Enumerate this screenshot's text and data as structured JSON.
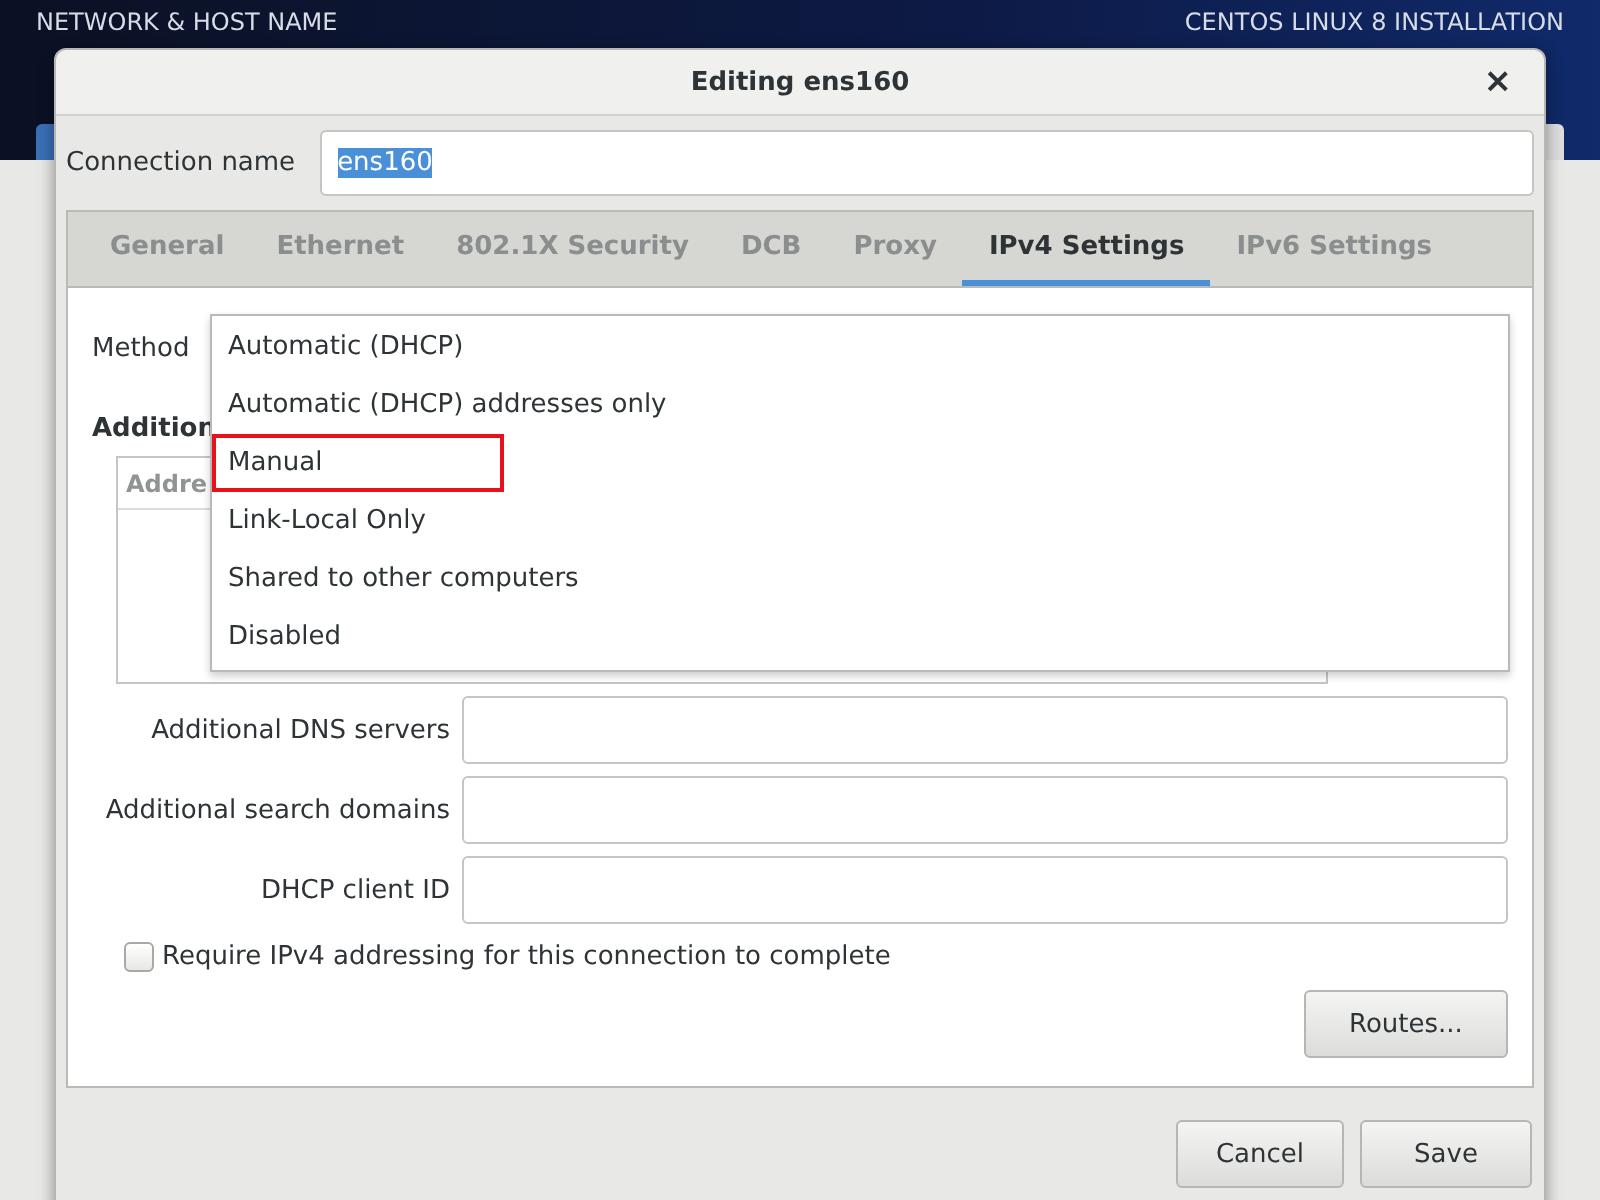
{
  "background": {
    "header_left": "NETWORK & HOST NAME",
    "header_right": "CENTOS LINUX 8 INSTALLATION"
  },
  "dialog": {
    "title": "Editing ens160",
    "close": "×"
  },
  "connection_name": {
    "label": "Connection name",
    "value": "ens160",
    "text_selected": true
  },
  "tabs": [
    {
      "label": "General",
      "selected": false
    },
    {
      "label": "Ethernet",
      "selected": false
    },
    {
      "label": "802.1X Security",
      "selected": false
    },
    {
      "label": "DCB",
      "selected": false
    },
    {
      "label": "Proxy",
      "selected": false
    },
    {
      "label": "IPv4 Settings",
      "selected": true
    },
    {
      "label": "IPv6 Settings",
      "selected": false
    }
  ],
  "ipv4": {
    "method_label": "Method",
    "section_heading": "Addition",
    "table_header": "Addre",
    "method_menu": [
      {
        "label": "Automatic (DHCP)",
        "highlighted": false
      },
      {
        "label": "Automatic (DHCP) addresses only",
        "highlighted": false
      },
      {
        "label": "Manual",
        "highlighted": true
      },
      {
        "label": "Link-Local Only",
        "highlighted": false
      },
      {
        "label": "Shared to other computers",
        "highlighted": false
      },
      {
        "label": "Disabled",
        "highlighted": false
      }
    ],
    "fields": [
      {
        "label": "Additional DNS servers"
      },
      {
        "label": "Additional search domains"
      },
      {
        "label": "DHCP client ID"
      }
    ],
    "require_checkbox": {
      "label": "Require IPv4 addressing for this connection to complete",
      "checked": false
    },
    "routes_button": "Routes..."
  },
  "buttons": [
    "Cancel",
    "Save"
  ]
}
